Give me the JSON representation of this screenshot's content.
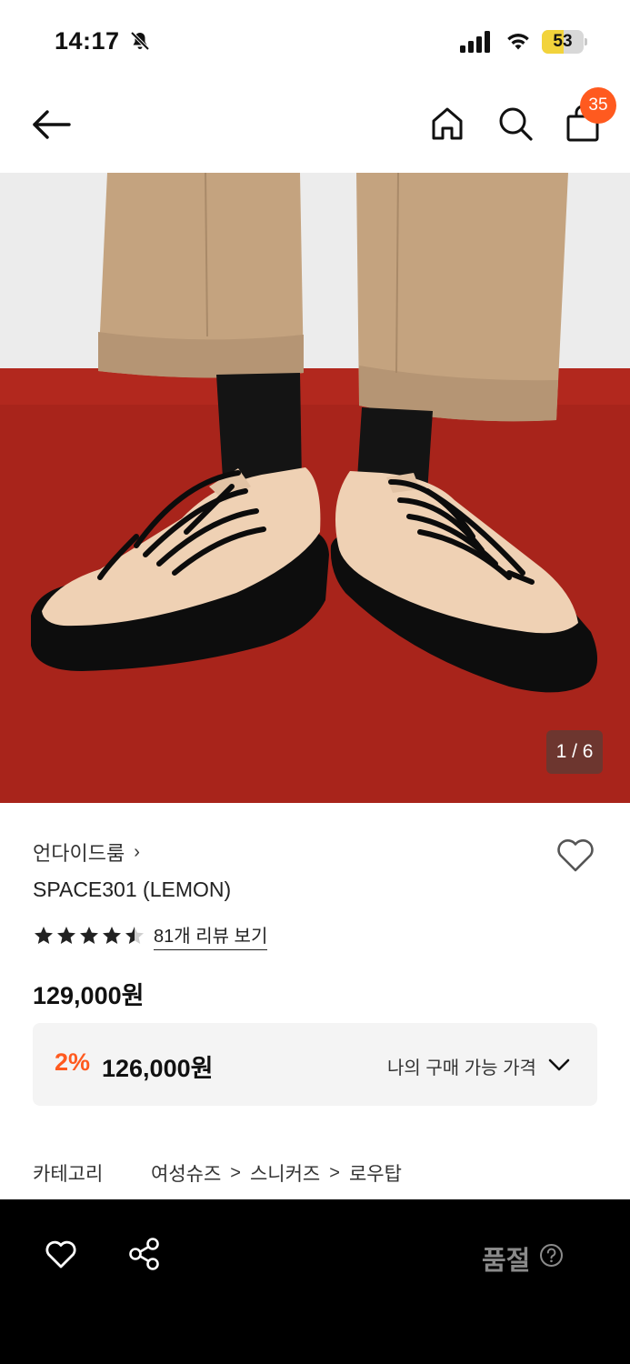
{
  "status_bar": {
    "time": "14:17",
    "battery_level": "53",
    "battery_percent": 53,
    "icons": [
      "bell-slash-icon",
      "cellular-signal-icon",
      "wifi-icon",
      "battery-icon"
    ]
  },
  "nav": {
    "icons": [
      "arrow-left-icon",
      "home-icon",
      "search-icon",
      "shopping-bag-icon"
    ],
    "cart_count": "35"
  },
  "gallery": {
    "counter": "1 / 6"
  },
  "product": {
    "brand": "언다이드룸",
    "brand_chevron": "›",
    "name": "SPACE301 (LEMON)",
    "rating": 4.5,
    "rating_max": 5,
    "review_link": "81개 리뷰 보기",
    "original_price": "129,000원",
    "discount_rate": "2%",
    "sale_price": "126,000원",
    "my_price_label": "나의 구매 가능 가격"
  },
  "category": {
    "label": "카테고리",
    "path": [
      "여성슈즈",
      "스니커즈",
      "로우탑"
    ],
    "separator": ">"
  },
  "bottom_bar": {
    "status": "품절",
    "icons": [
      "heart-icon",
      "share-icon",
      "question-circle-icon"
    ]
  },
  "colors": {
    "accent": "#ff5a1f",
    "bottom_bar": "#000000",
    "price_box": "#f4f4f4",
    "disabled_text": "#8a8a8a"
  }
}
